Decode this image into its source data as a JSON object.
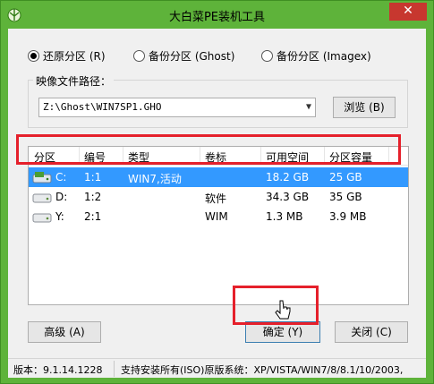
{
  "window": {
    "title": "大白菜PE装机工具",
    "close_label": "✕"
  },
  "mode": {
    "options": [
      {
        "label": "还原分区 (R)",
        "selected": true
      },
      {
        "label": "备份分区 (Ghost)",
        "selected": false
      },
      {
        "label": "备份分区 (Imagex)",
        "selected": false
      }
    ]
  },
  "image": {
    "group_label": "映像文件路径：",
    "path": "Z:\\Ghost\\WIN7SP1.GHO",
    "browse_label": "浏览 (B)"
  },
  "partitions": {
    "columns": [
      "分区",
      "编号",
      "类型",
      "卷标",
      "可用空间",
      "分区容量"
    ],
    "rows": [
      {
        "drive": "C:",
        "number": "1:1",
        "type": "WIN7,活动",
        "label": "",
        "free": "18.2 GB",
        "size": "25 GB",
        "selected": true
      },
      {
        "drive": "D:",
        "number": "1:2",
        "type": "",
        "label": "软件",
        "free": "34.3 GB",
        "size": "35 GB",
        "selected": false
      },
      {
        "drive": "Y:",
        "number": "2:1",
        "type": "",
        "label": "WIM",
        "free": "1.3 MB",
        "size": "3.9 MB",
        "selected": false
      }
    ]
  },
  "buttons": {
    "advanced": "高级 (A)",
    "ok": "确定 (Y)",
    "close": "关闭 (C)"
  },
  "status": {
    "version": "版本：9.1.14.1228",
    "support": "支持安装所有(ISO)原版系统：XP/VISTA/WIN7/8/8.1/10/2003,"
  },
  "colors": {
    "frame": "#5eb33a",
    "selection": "#3399ff",
    "annotation": "#e5202b",
    "close_button": "#c7372f"
  }
}
